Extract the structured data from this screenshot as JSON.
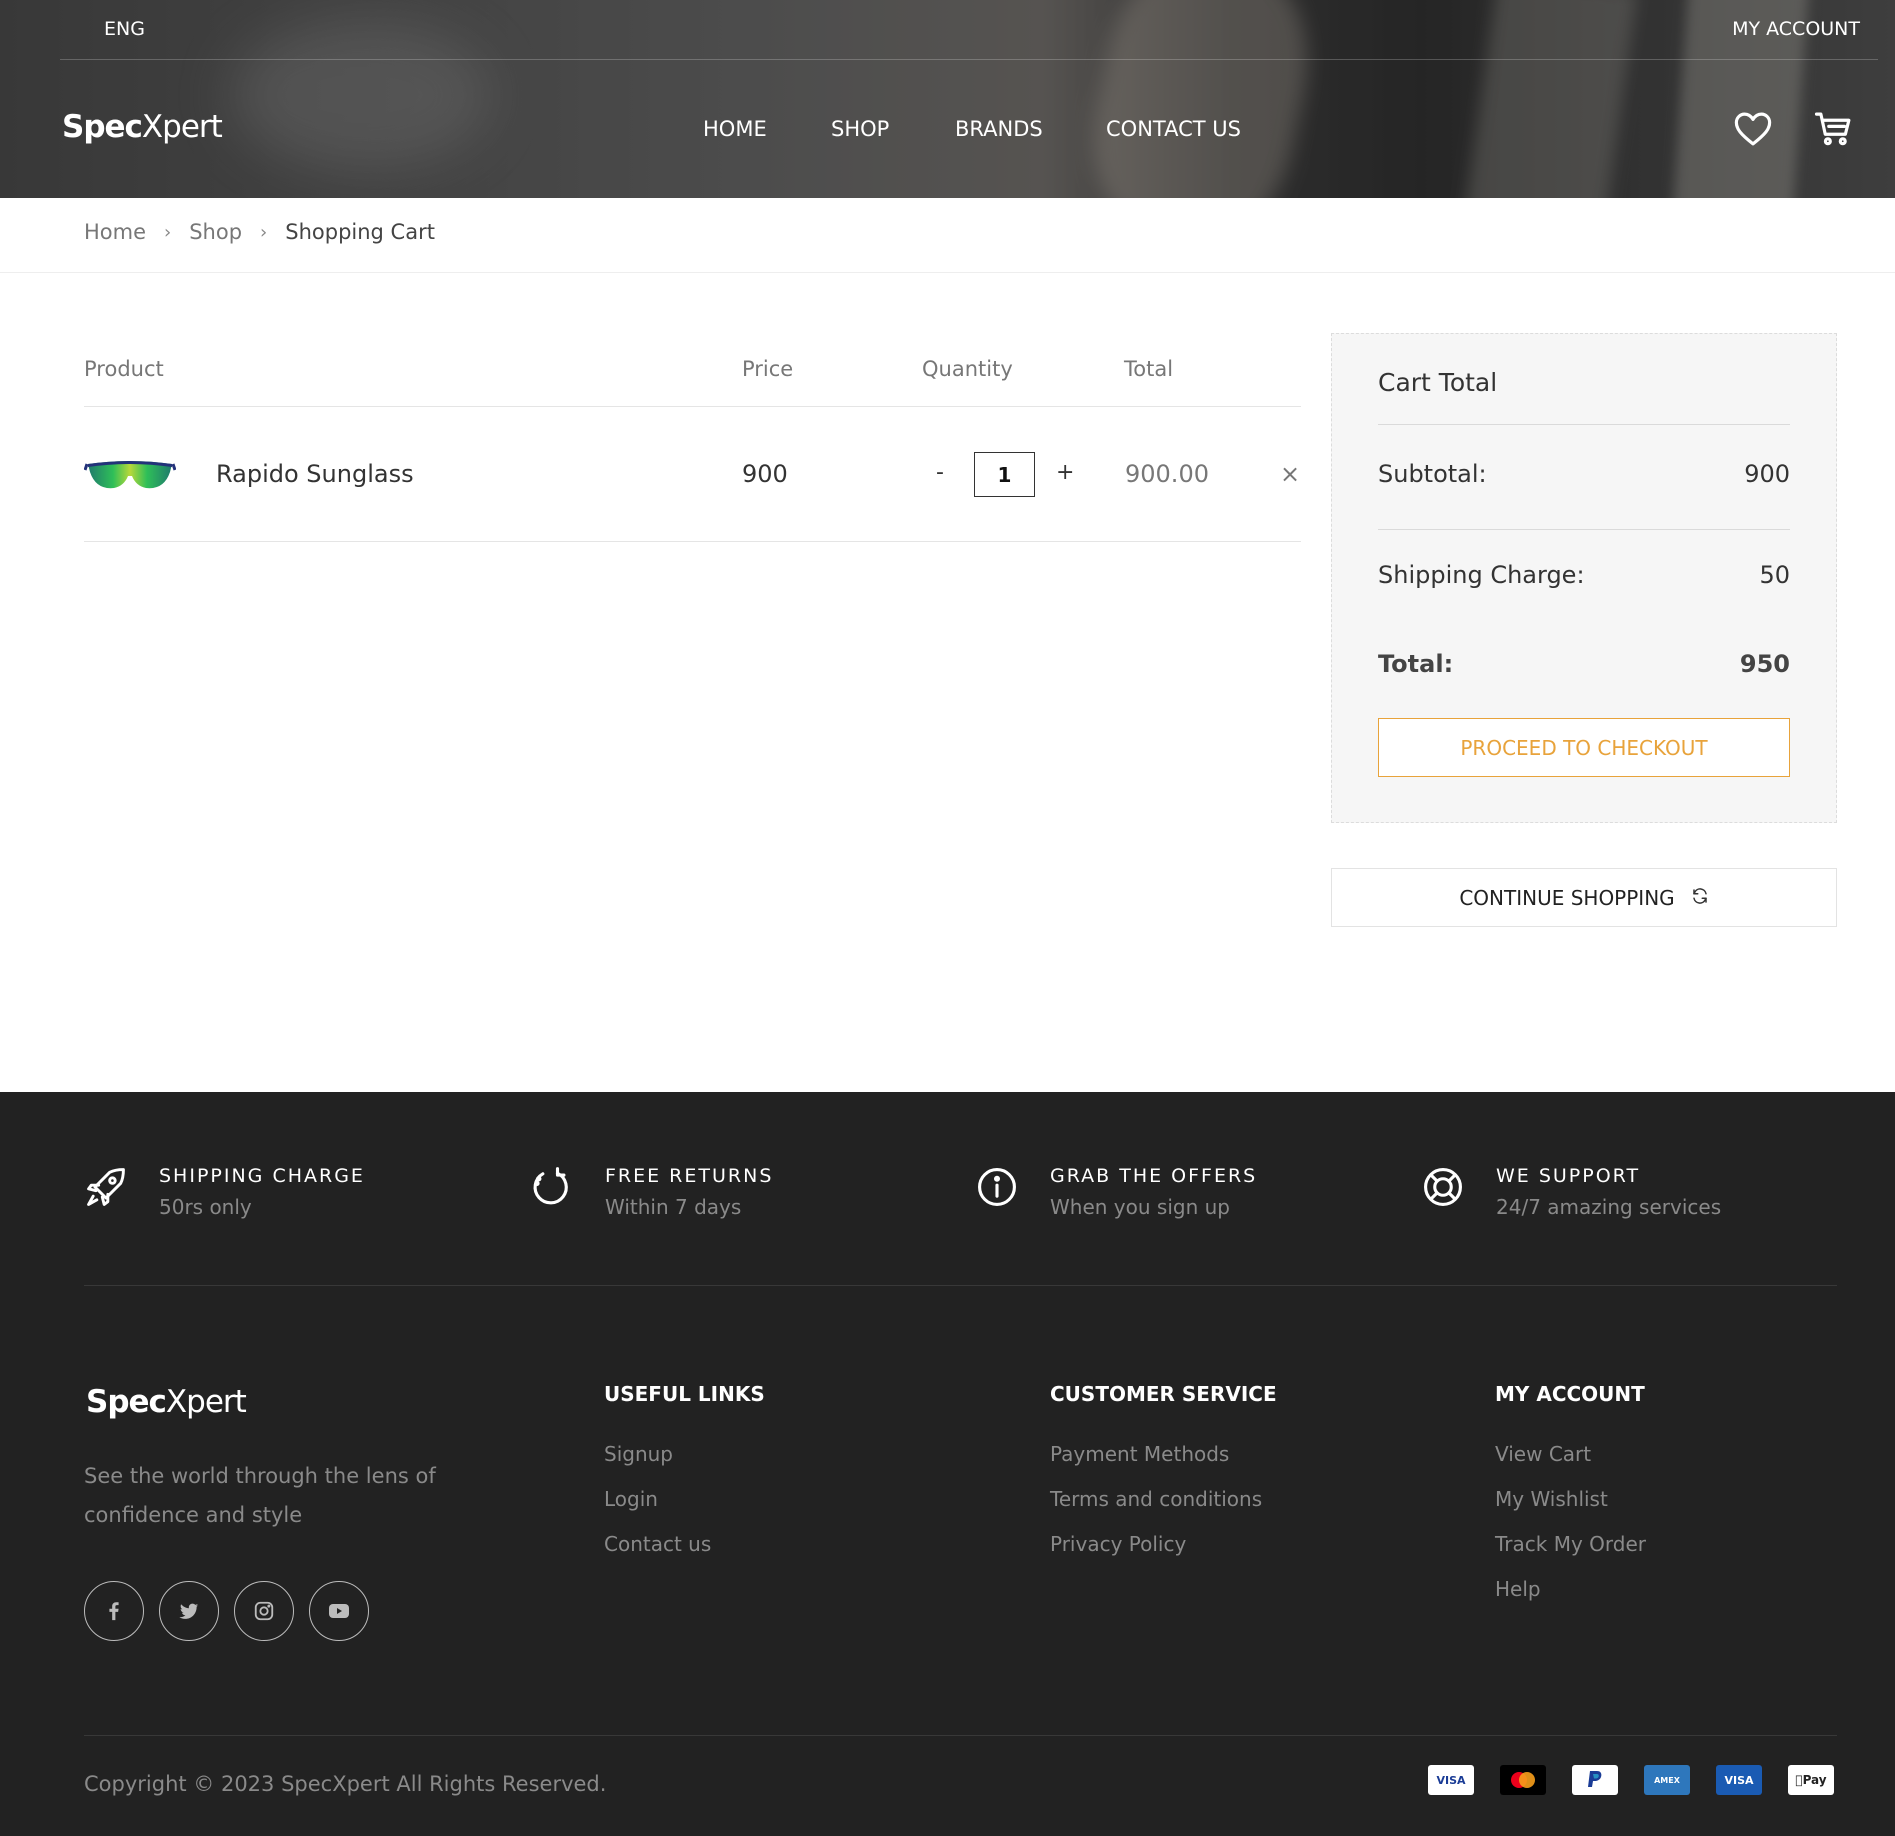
{
  "header": {
    "language": "ENG",
    "my_account": "MY ACCOUNT",
    "logo_bold": "Spec",
    "logo_thin": "Xpert",
    "nav": [
      "HOME",
      "SHOP",
      "BRANDS",
      "CONTACT US"
    ],
    "icons": [
      "heart-icon",
      "cart-icon"
    ]
  },
  "breadcrumb": {
    "items": [
      "Home",
      "Shop",
      "Shopping Cart"
    ]
  },
  "cart": {
    "columns": [
      "Product",
      "Price",
      "Quantity",
      "Total"
    ],
    "items": [
      {
        "name": "Rapido Sunglass",
        "price": "900",
        "quantity": "1",
        "total": "900.00",
        "minus": "-",
        "plus": "+",
        "remove": "×"
      }
    ]
  },
  "cart_total": {
    "title": "Cart Total",
    "subtotal_label": "Subtotal:",
    "subtotal_value": "900",
    "shipping_label": "Shipping Charge:",
    "shipping_value": "50",
    "total_label": "Total:",
    "total_value": "950",
    "checkout_label": "PROCEED TO CHECKOUT",
    "continue_label": "CONTINUE SHOPPING"
  },
  "features": [
    {
      "title": "SHIPPING CHARGE",
      "subtitle": "50rs only",
      "icon": "rocket-icon"
    },
    {
      "title": "FREE RETURNS",
      "subtitle": "Within 7 days",
      "icon": "refresh-icon"
    },
    {
      "title": "GRAB THE OFFERS",
      "subtitle": "When you sign up",
      "icon": "info-icon"
    },
    {
      "title": "WE SUPPORT",
      "subtitle": "24/7 amazing services",
      "icon": "lifebuoy-icon"
    }
  ],
  "footer": {
    "logo_bold": "Spec",
    "logo_thin": "Xpert",
    "description": "See the world through the lens of confidence and style",
    "useful_links": {
      "title": "USEFUL LINKS",
      "links": [
        "Signup",
        "Login",
        "Contact us"
      ]
    },
    "customer_service": {
      "title": "CUSTOMER SERVICE",
      "links": [
        "Payment Methods",
        "Terms and conditions",
        "Privacy Policy"
      ]
    },
    "my_account": {
      "title": "MY ACCOUNT",
      "links": [
        "View Cart",
        "My Wishlist",
        "Track My Order",
        "Help"
      ]
    },
    "social_icons": [
      "facebook-icon",
      "twitter-icon",
      "instagram-icon",
      "youtube-icon"
    ],
    "copyright": "Copyright © 2023 SpecXpert All Rights Reserved.",
    "payment_icons": [
      "visa-icon",
      "mastercard-icon",
      "paypal-icon",
      "amex-icon",
      "visa-electron-icon",
      "apple-pay-icon"
    ]
  },
  "colors": {
    "accent": "#e8a33b",
    "footer_bg": "#222222",
    "box_bg": "#f6f6f6"
  }
}
